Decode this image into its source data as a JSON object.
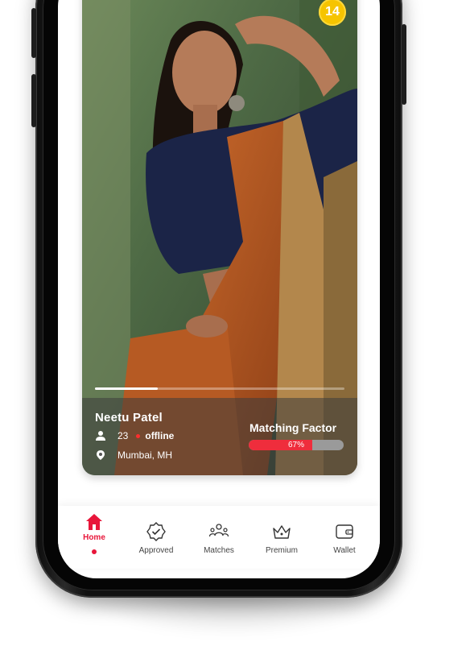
{
  "profile": {
    "badge_count": "14",
    "name": "Neetu Patel",
    "age": "23",
    "status": "offline",
    "location": "Mumbai, MH",
    "photo_progress": 0.25
  },
  "matching": {
    "label": "Matching Factor",
    "percent_text": "67%",
    "percent": 67
  },
  "nav": {
    "items": [
      {
        "label": "Home",
        "icon": "home-icon",
        "active": true
      },
      {
        "label": "Approved",
        "icon": "approved-badge-icon",
        "active": false
      },
      {
        "label": "Matches",
        "icon": "matches-people-icon",
        "active": false
      },
      {
        "label": "Premium",
        "icon": "crown-icon",
        "active": false
      },
      {
        "label": "Wallet",
        "icon": "wallet-icon",
        "active": false
      }
    ]
  },
  "colors": {
    "accent": "#e8163a",
    "badge": "#f6c400",
    "matching_bar": "#ef2d3c"
  }
}
